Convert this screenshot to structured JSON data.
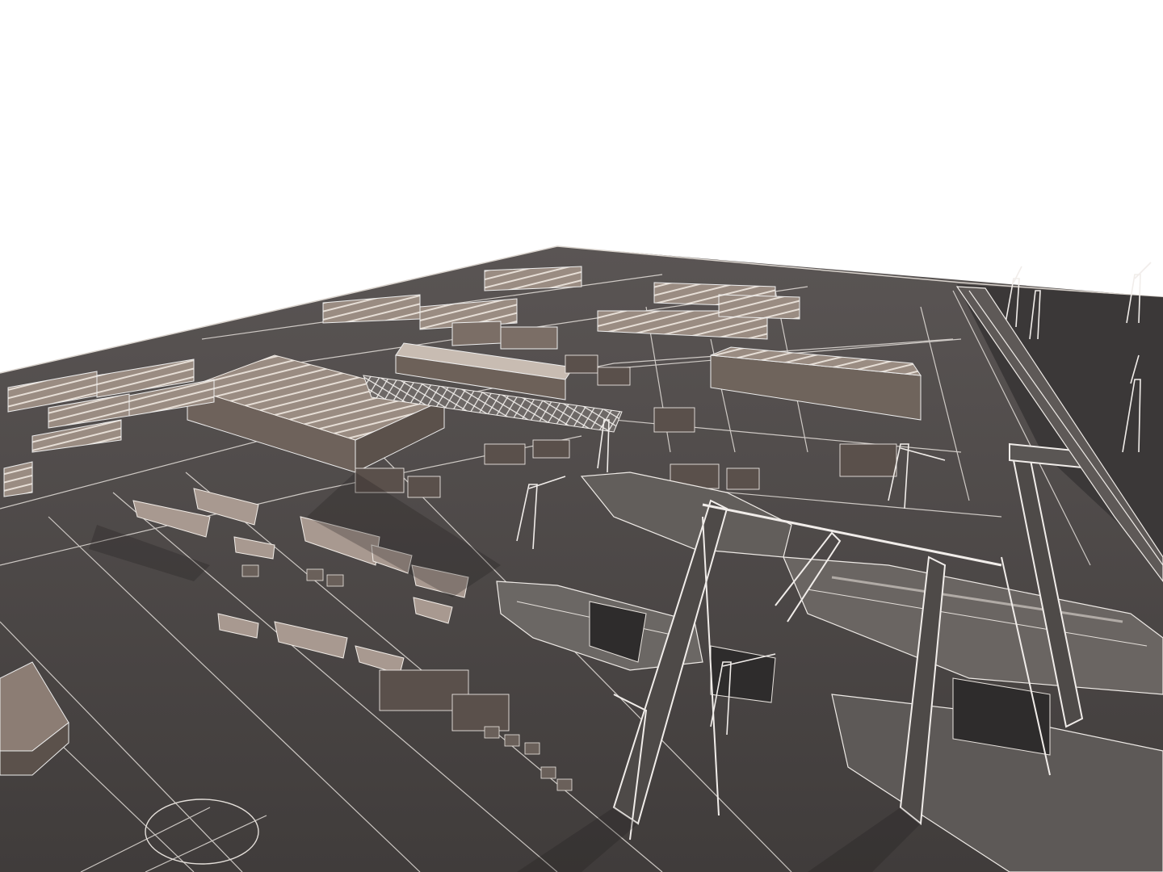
{
  "scene": {
    "description_tag": "shipyard-wireframe-render",
    "colors": {
      "sky": "#ffffff",
      "ground": "#4a4645",
      "ground_dark": "#3a3736",
      "wire": "#e9e6e2",
      "roof_warm": "#8a7d74",
      "roof_light": "#b9aea5",
      "shadow": "#2c2a2a",
      "water": "#3e3b3b"
    }
  }
}
